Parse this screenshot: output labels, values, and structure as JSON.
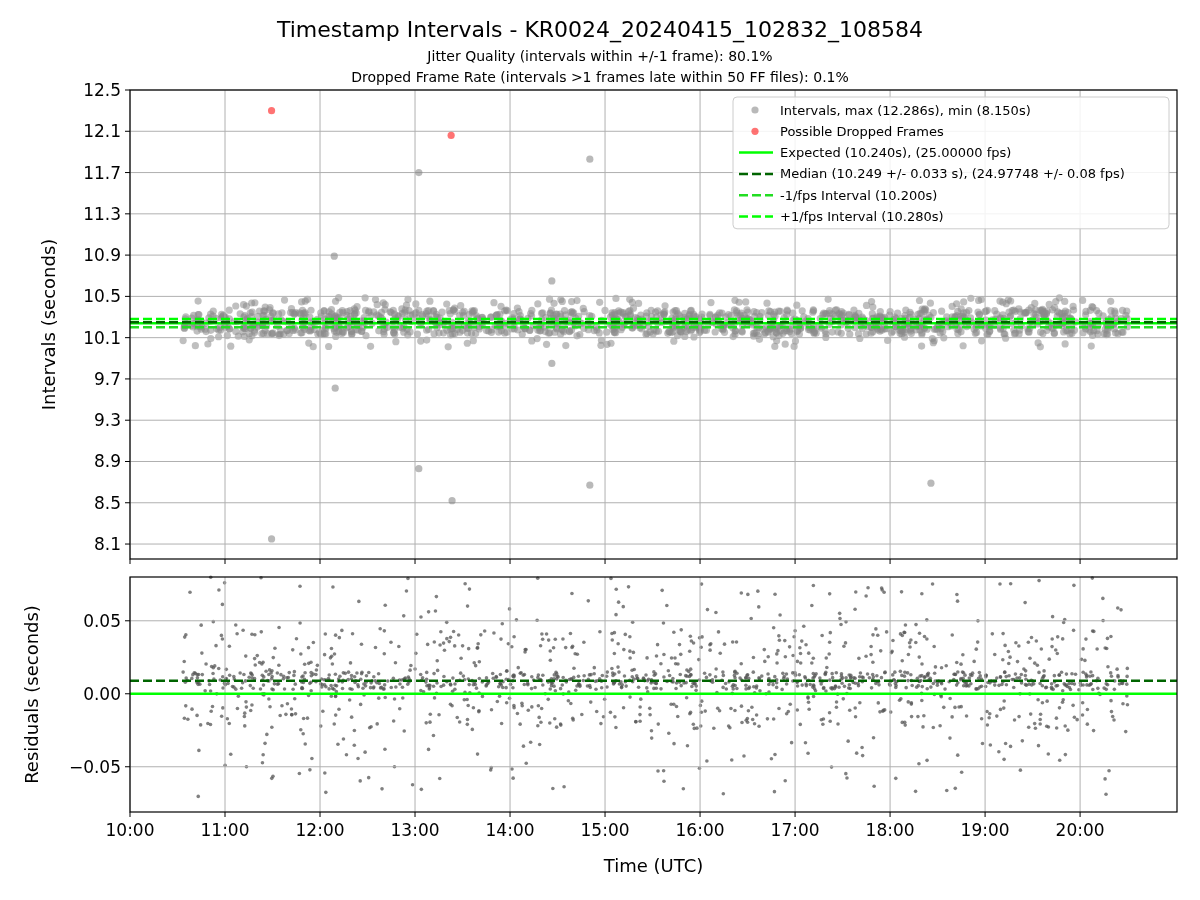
{
  "title": "Timestamp Intervals - KR0024_20240415_102832_108584",
  "subtitles": [
    "Jitter Quality (intervals within +/-1 frame): 80.1%",
    "Dropped Frame Rate (intervals >1 frames late within 50 FF files): 0.1%"
  ],
  "charts": [
    {
      "chart_data": {
        "type": "scatter",
        "ylabel": "Intervals (seconds)",
        "grid": true,
        "xlim": [
          10,
          21.02
        ],
        "ylim": [
          7.955,
          12.5
        ],
        "yticks": [
          {
            "value": 8.1,
            "label": "8.1"
          },
          {
            "value": 8.5,
            "label": "8.5"
          },
          {
            "value": 8.9,
            "label": "8.9"
          },
          {
            "value": 9.3,
            "label": "9.3"
          },
          {
            "value": 9.7,
            "label": "9.7"
          },
          {
            "value": 10.1,
            "label": "10.1"
          },
          {
            "value": 10.5,
            "label": "10.5"
          },
          {
            "value": 10.9,
            "label": "10.9"
          },
          {
            "value": 11.3,
            "label": "11.3"
          },
          {
            "value": 11.7,
            "label": "11.7"
          },
          {
            "value": 12.1,
            "label": "12.1"
          },
          {
            "value": 12.5,
            "label": "12.5"
          }
        ],
        "x": [
          11.49,
          12.15,
          12.16,
          13.04,
          13.04,
          13.39,
          14.44,
          14.44,
          14.84,
          14.84,
          18.43,
          11.49,
          13.38
        ],
        "series": [
          {
            "name": "Intervals, max (12.286s), min (8.150s)",
            "color": "#808080",
            "values": [
              8.15,
              10.89,
              9.61,
              11.7,
              8.83,
              8.52,
              9.85,
              10.65,
              11.83,
              8.67,
              8.69,
              null,
              null
            ]
          },
          {
            "name": "Possible Dropped Frames",
            "color": "#ff0000",
            "values": [
              null,
              null,
              null,
              null,
              null,
              null,
              null,
              null,
              null,
              null,
              null,
              12.3,
              12.06
            ]
          }
        ],
        "ref_lines": [
          {
            "axis": "y",
            "value": 10.24,
            "label": "Expected (10.240s), (25.00000 fps)",
            "color": "#00ff00"
          },
          {
            "axis": "y",
            "value": 10.25,
            "label": "Median (10.249 +/- 0.033 s), (24.97748 +/- 0.08 fps)",
            "color": "#006400"
          },
          {
            "axis": "y",
            "value": 10.2,
            "label": "-1/fps Interval (10.200s)",
            "color": "#22dd22"
          },
          {
            "axis": "y",
            "value": 10.28,
            "label": "+1/fps Interval (10.280s)",
            "color": "#00ff00"
          }
        ],
        "legend": true
      }
    },
    {
      "chart_data": {
        "type": "scatter",
        "xlabel": "Time (UTC)",
        "ylabel": "Residuals (seconds)",
        "grid": true,
        "xlim": [
          10,
          21.02
        ],
        "ylim": [
          -0.081,
          0.08
        ],
        "xticks": [
          {
            "value": 10,
            "label": "10:00"
          },
          {
            "value": 11,
            "label": "11:00"
          },
          {
            "value": 12,
            "label": "12:00"
          },
          {
            "value": 13,
            "label": "13:00"
          },
          {
            "value": 14,
            "label": "14:00"
          },
          {
            "value": 15,
            "label": "15:00"
          },
          {
            "value": 16,
            "label": "16:00"
          },
          {
            "value": 17,
            "label": "17:00"
          },
          {
            "value": 18,
            "label": "18:00"
          },
          {
            "value": 19,
            "label": "19:00"
          },
          {
            "value": 20,
            "label": "20:00"
          }
        ],
        "yticks": [
          {
            "value": 0.05,
            "label": "0.05"
          },
          {
            "value": 0,
            "label": "0.00"
          },
          {
            "value": -0.05,
            "label": "−0.05"
          }
        ],
        "ref_lines": [
          {
            "axis": "y",
            "value": 0,
            "color": "#00ff00"
          },
          {
            "axis": "y",
            "value": 0.009,
            "color": "#006400"
          }
        ]
      }
    }
  ]
}
